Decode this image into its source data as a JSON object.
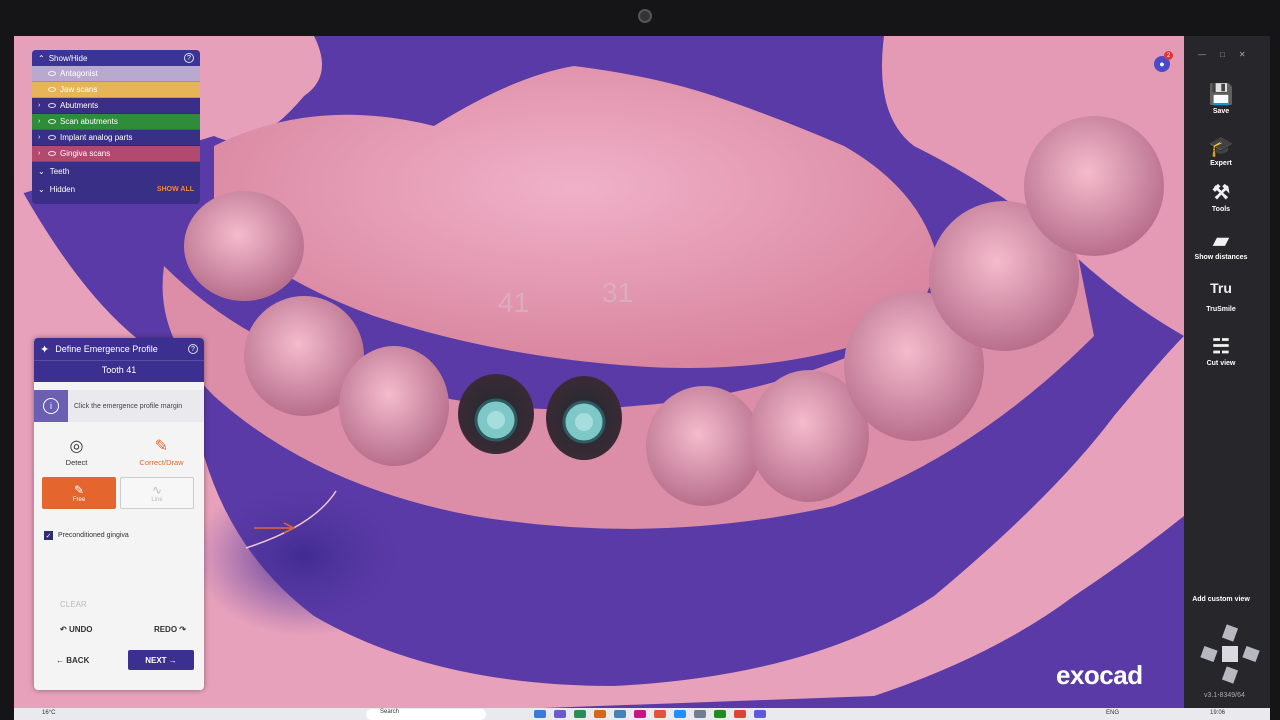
{
  "show_hide": {
    "title": "Show/Hide",
    "layers": [
      {
        "label": "Antagonist",
        "color": "#b9a9cf",
        "expand": "",
        "text_color": "#ffffff"
      },
      {
        "label": "Jaw scans",
        "color": "#e8b458",
        "expand": "",
        "text_color": "#ffffff"
      },
      {
        "label": "Abutments",
        "color": "#3a2f86",
        "expand": "›",
        "text_color": "#ffffff"
      },
      {
        "label": "Scan abutments",
        "color": "#2f8c3b",
        "expand": "›",
        "text_color": "#ffffff"
      },
      {
        "label": "Implant analog parts",
        "color": "#3a2f86",
        "expand": "›",
        "text_color": "#ffffff"
      },
      {
        "label": "Gingiva scans",
        "color": "#b24a6d",
        "expand": "›",
        "text_color": "#ffffff"
      }
    ],
    "groups": [
      {
        "label": "Teeth"
      },
      {
        "label": "Hidden",
        "action": "SHOW ALL"
      }
    ]
  },
  "workflow": {
    "title": "Define Emergence Profile",
    "subtitle": "Tooth 41",
    "hint": "Click the emergence profile margin",
    "tools": [
      {
        "label": "Detect",
        "icon": "detect-icon"
      },
      {
        "label": "Correct/Draw",
        "icon": "draw-icon"
      }
    ],
    "modes": [
      {
        "label": "Free",
        "icon": "pencil-icon"
      },
      {
        "label": "Line",
        "icon": "line-icon"
      }
    ],
    "checkbox_label": "Preconditioned gingiva",
    "clear": "CLEAR",
    "undo": "UNDO",
    "redo": "REDO",
    "back": "BACK",
    "next": "NEXT"
  },
  "viewport": {
    "tooth_labels": [
      "41",
      "31"
    ],
    "logo": "exocad",
    "notification_count": "2"
  },
  "sidebar": {
    "items": [
      {
        "label": "Save",
        "icon": "save-icon"
      },
      {
        "label": "Expert",
        "icon": "expert-icon"
      },
      {
        "label": "Tools",
        "icon": "tools-icon"
      },
      {
        "label": "Show distances",
        "icon": "distances-icon"
      },
      {
        "label": "TruSmile",
        "icon": "trusmile-icon"
      },
      {
        "label": "Cut view",
        "icon": "cutview-icon"
      }
    ],
    "add_view": "Add custom view",
    "version": "v3.1-8349/64"
  },
  "taskbar": {
    "weather": "16°C",
    "search": "Search",
    "lang": "ENG",
    "time": "19:06"
  },
  "colors": {
    "background": "#5a3aa6",
    "gingiva": "#e8a1bb",
    "accent": "#e4662e",
    "panel": "#3b2f90"
  }
}
